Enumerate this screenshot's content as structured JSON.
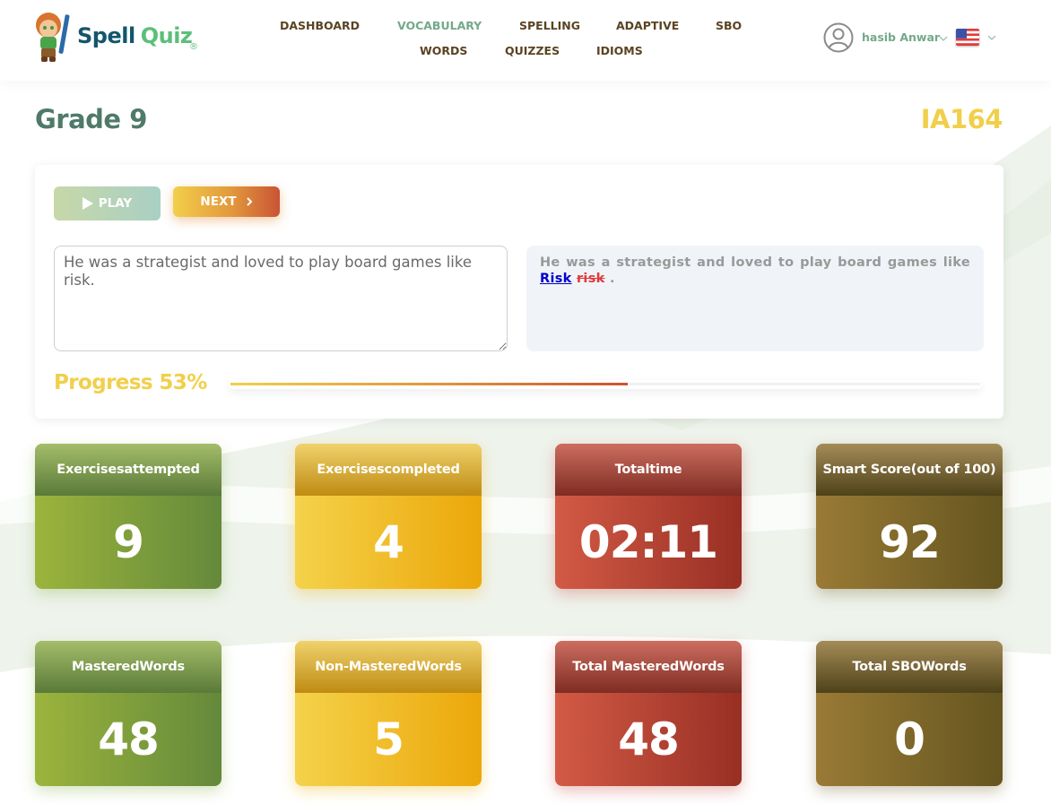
{
  "brand": {
    "name_part1": "Spell",
    "name_part2": "Quiz",
    "registered": "®"
  },
  "nav": {
    "items": [
      {
        "label": "DASHBOARD",
        "active": false
      },
      {
        "label": "VOCABULARY",
        "active": true
      },
      {
        "label": "SPELLING",
        "active": false
      },
      {
        "label": "ADAPTIVE",
        "active": false
      },
      {
        "label": "SBO",
        "active": false
      },
      {
        "label": "WORDS",
        "active": false
      },
      {
        "label": "QUIZZES",
        "active": false
      },
      {
        "label": "IDIOMS",
        "active": false
      }
    ]
  },
  "user": {
    "name": "hasib Anwar",
    "icon": "user-circle-icon",
    "language_flag": "us-flag-icon"
  },
  "page": {
    "title": "Grade 9",
    "quiz_code": "IA164"
  },
  "controls": {
    "play_label": "PLAY",
    "play_icon": "play-icon",
    "next_label": "NEXT",
    "next_icon": "chevron-right-icon"
  },
  "answer": {
    "value": "He was a strategist and loved to play board games like risk."
  },
  "result": {
    "prefix": "He was a strategist and loved to play board games like",
    "correct_word": "Risk",
    "wrong_word": "risk",
    "suffix": "."
  },
  "progress": {
    "label": "Progress 53%",
    "percent": 53
  },
  "stats": [
    {
      "title_line1": "Exercises",
      "title_line2": "attempted",
      "value": "9",
      "theme": "green"
    },
    {
      "title_line1": "Exercises",
      "title_line2": "completed",
      "value": "4",
      "theme": "yellow"
    },
    {
      "title_line1": "Total",
      "title_line2": "time",
      "value": "02:11",
      "theme": "red"
    },
    {
      "title_line1": "Smart Score",
      "title_line2": "(out of 100)",
      "value": "92",
      "theme": "olive"
    },
    {
      "title_line1": "Mastered",
      "title_line2": "Words",
      "value": "48",
      "theme": "green"
    },
    {
      "title_line1": "Non-Mastered",
      "title_line2": "Words",
      "value": "5",
      "theme": "yellow"
    },
    {
      "title_line1": "Total Mastered",
      "title_line2": "Words",
      "value": "48",
      "theme": "red"
    },
    {
      "title_line1": "Total SBO",
      "title_line2": "Words",
      "value": "0",
      "theme": "olive"
    }
  ],
  "colors": {
    "nav_text": "#5a4322",
    "nav_active": "#74a98a",
    "title": "#4f7a6a",
    "quiz_code": "#f2cf4a",
    "progress_label": "#f2cf4a",
    "correct_word": "#0000cc",
    "wrong_word": "#e13a3a"
  }
}
